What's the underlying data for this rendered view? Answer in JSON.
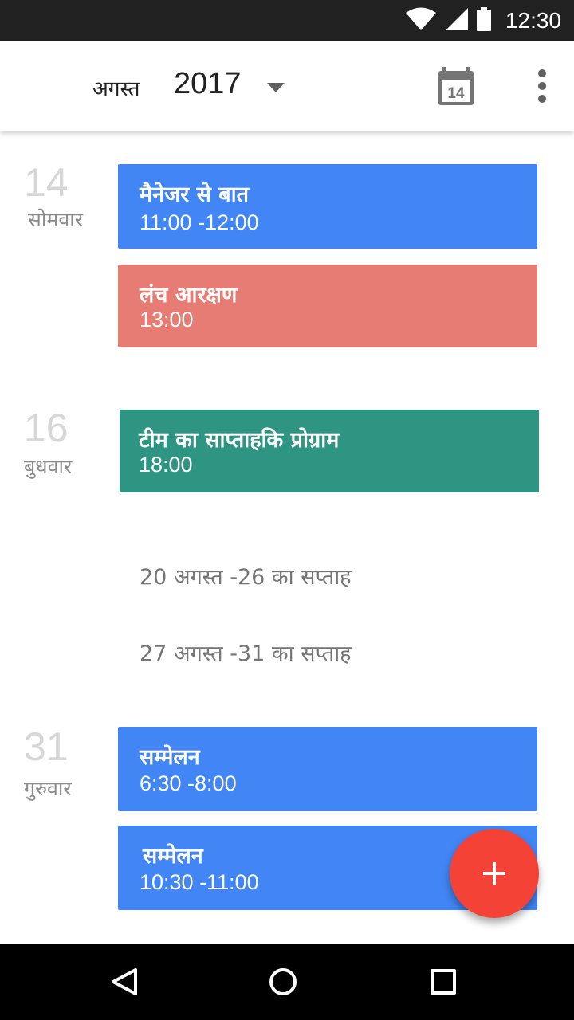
{
  "status_bar": {
    "time": "12:30"
  },
  "header": {
    "month": "अगस्त",
    "year": "2017",
    "today_icon_day": "14"
  },
  "days": [
    {
      "day_number": "14",
      "day_name": "सोमवार",
      "events": [
        {
          "title": "मैनेजर से बात",
          "time": "11:00 -12:00",
          "color": "#4285f4"
        },
        {
          "title": "लंच आरक्षण",
          "time": "13:00",
          "color": "#e67c73"
        }
      ]
    },
    {
      "day_number": "16",
      "day_name": "बुधवार",
      "events": [
        {
          "title": "टीम का  साप्ताहकि प्रोग्राम",
          "time": "18:00",
          "color": "#2e9583"
        }
      ]
    },
    {
      "day_number": "31",
      "day_name": "गुरुवार",
      "events": [
        {
          "title": "सम्मेलन",
          "time": "6:30 -8:00",
          "color": "#4285f4"
        },
        {
          "title": "सम्मेलन",
          "time": "10:30 -11:00",
          "color": "#4285f4"
        }
      ]
    }
  ],
  "weeks": [
    {
      "label": "20 अगस्त -26 का सप्ताह"
    },
    {
      "label": "27 अगस्त -31 का सप्ताह"
    }
  ],
  "colors": {
    "fab": "#f44336",
    "status_bar": "#212121",
    "nav_bar": "#000000"
  }
}
